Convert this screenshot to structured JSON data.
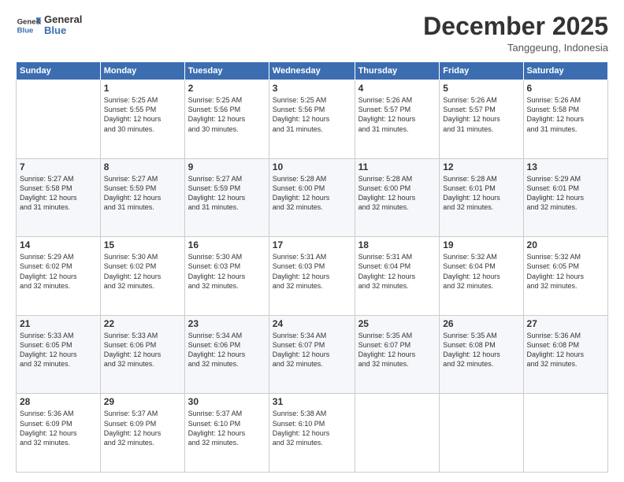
{
  "header": {
    "logo_line1": "General",
    "logo_line2": "Blue",
    "month": "December 2025",
    "location": "Tanggeung, Indonesia"
  },
  "weekdays": [
    "Sunday",
    "Monday",
    "Tuesday",
    "Wednesday",
    "Thursday",
    "Friday",
    "Saturday"
  ],
  "weeks": [
    [
      {
        "day": "",
        "info": ""
      },
      {
        "day": "1",
        "info": "Sunrise: 5:25 AM\nSunset: 5:55 PM\nDaylight: 12 hours\nand 30 minutes."
      },
      {
        "day": "2",
        "info": "Sunrise: 5:25 AM\nSunset: 5:56 PM\nDaylight: 12 hours\nand 30 minutes."
      },
      {
        "day": "3",
        "info": "Sunrise: 5:25 AM\nSunset: 5:56 PM\nDaylight: 12 hours\nand 31 minutes."
      },
      {
        "day": "4",
        "info": "Sunrise: 5:26 AM\nSunset: 5:57 PM\nDaylight: 12 hours\nand 31 minutes."
      },
      {
        "day": "5",
        "info": "Sunrise: 5:26 AM\nSunset: 5:57 PM\nDaylight: 12 hours\nand 31 minutes."
      },
      {
        "day": "6",
        "info": "Sunrise: 5:26 AM\nSunset: 5:58 PM\nDaylight: 12 hours\nand 31 minutes."
      }
    ],
    [
      {
        "day": "7",
        "info": "Sunrise: 5:27 AM\nSunset: 5:58 PM\nDaylight: 12 hours\nand 31 minutes."
      },
      {
        "day": "8",
        "info": "Sunrise: 5:27 AM\nSunset: 5:59 PM\nDaylight: 12 hours\nand 31 minutes."
      },
      {
        "day": "9",
        "info": "Sunrise: 5:27 AM\nSunset: 5:59 PM\nDaylight: 12 hours\nand 31 minutes."
      },
      {
        "day": "10",
        "info": "Sunrise: 5:28 AM\nSunset: 6:00 PM\nDaylight: 12 hours\nand 32 minutes."
      },
      {
        "day": "11",
        "info": "Sunrise: 5:28 AM\nSunset: 6:00 PM\nDaylight: 12 hours\nand 32 minutes."
      },
      {
        "day": "12",
        "info": "Sunrise: 5:28 AM\nSunset: 6:01 PM\nDaylight: 12 hours\nand 32 minutes."
      },
      {
        "day": "13",
        "info": "Sunrise: 5:29 AM\nSunset: 6:01 PM\nDaylight: 12 hours\nand 32 minutes."
      }
    ],
    [
      {
        "day": "14",
        "info": "Sunrise: 5:29 AM\nSunset: 6:02 PM\nDaylight: 12 hours\nand 32 minutes."
      },
      {
        "day": "15",
        "info": "Sunrise: 5:30 AM\nSunset: 6:02 PM\nDaylight: 12 hours\nand 32 minutes."
      },
      {
        "day": "16",
        "info": "Sunrise: 5:30 AM\nSunset: 6:03 PM\nDaylight: 12 hours\nand 32 minutes."
      },
      {
        "day": "17",
        "info": "Sunrise: 5:31 AM\nSunset: 6:03 PM\nDaylight: 12 hours\nand 32 minutes."
      },
      {
        "day": "18",
        "info": "Sunrise: 5:31 AM\nSunset: 6:04 PM\nDaylight: 12 hours\nand 32 minutes."
      },
      {
        "day": "19",
        "info": "Sunrise: 5:32 AM\nSunset: 6:04 PM\nDaylight: 12 hours\nand 32 minutes."
      },
      {
        "day": "20",
        "info": "Sunrise: 5:32 AM\nSunset: 6:05 PM\nDaylight: 12 hours\nand 32 minutes."
      }
    ],
    [
      {
        "day": "21",
        "info": "Sunrise: 5:33 AM\nSunset: 6:05 PM\nDaylight: 12 hours\nand 32 minutes."
      },
      {
        "day": "22",
        "info": "Sunrise: 5:33 AM\nSunset: 6:06 PM\nDaylight: 12 hours\nand 32 minutes."
      },
      {
        "day": "23",
        "info": "Sunrise: 5:34 AM\nSunset: 6:06 PM\nDaylight: 12 hours\nand 32 minutes."
      },
      {
        "day": "24",
        "info": "Sunrise: 5:34 AM\nSunset: 6:07 PM\nDaylight: 12 hours\nand 32 minutes."
      },
      {
        "day": "25",
        "info": "Sunrise: 5:35 AM\nSunset: 6:07 PM\nDaylight: 12 hours\nand 32 minutes."
      },
      {
        "day": "26",
        "info": "Sunrise: 5:35 AM\nSunset: 6:08 PM\nDaylight: 12 hours\nand 32 minutes."
      },
      {
        "day": "27",
        "info": "Sunrise: 5:36 AM\nSunset: 6:08 PM\nDaylight: 12 hours\nand 32 minutes."
      }
    ],
    [
      {
        "day": "28",
        "info": "Sunrise: 5:36 AM\nSunset: 6:09 PM\nDaylight: 12 hours\nand 32 minutes."
      },
      {
        "day": "29",
        "info": "Sunrise: 5:37 AM\nSunset: 6:09 PM\nDaylight: 12 hours\nand 32 minutes."
      },
      {
        "day": "30",
        "info": "Sunrise: 5:37 AM\nSunset: 6:10 PM\nDaylight: 12 hours\nand 32 minutes."
      },
      {
        "day": "31",
        "info": "Sunrise: 5:38 AM\nSunset: 6:10 PM\nDaylight: 12 hours\nand 32 minutes."
      },
      {
        "day": "",
        "info": ""
      },
      {
        "day": "",
        "info": ""
      },
      {
        "day": "",
        "info": ""
      }
    ]
  ]
}
